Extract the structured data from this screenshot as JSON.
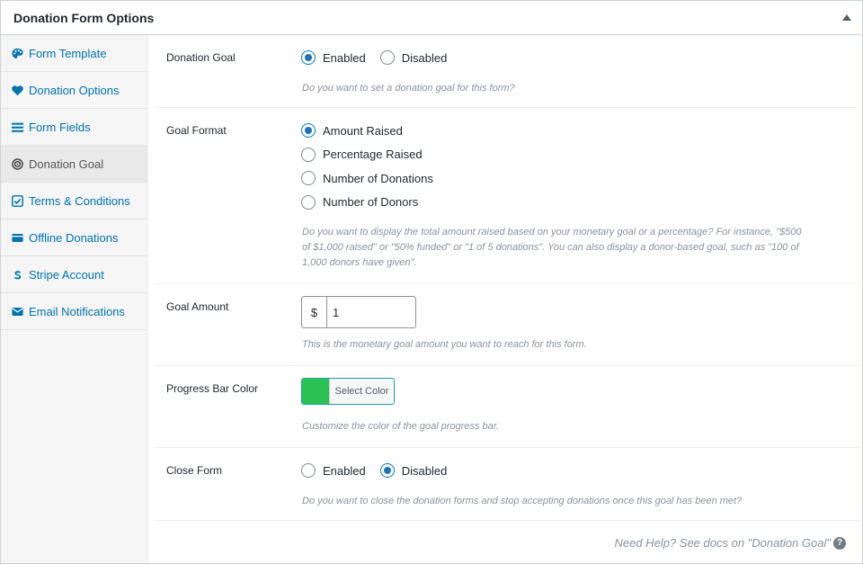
{
  "panel": {
    "title": "Donation Form Options"
  },
  "sidebar": {
    "items": [
      {
        "label": "Form Template",
        "icon": "palette-icon"
      },
      {
        "label": "Donation Options",
        "icon": "heart-icon"
      },
      {
        "label": "Form Fields",
        "icon": "bars-icon"
      },
      {
        "label": "Donation Goal",
        "icon": "target-icon",
        "active": true
      },
      {
        "label": "Terms & Conditions",
        "icon": "checkbox-icon"
      },
      {
        "label": "Offline Donations",
        "icon": "wallet-icon"
      },
      {
        "label": "Stripe Account",
        "icon": "stripe-icon"
      },
      {
        "label": "Email Notifications",
        "icon": "envelope-icon"
      }
    ]
  },
  "fields": {
    "donation_goal": {
      "label": "Donation Goal",
      "options": [
        "Enabled",
        "Disabled"
      ],
      "selected": "Enabled",
      "description": "Do you want to set a donation goal for this form?"
    },
    "goal_format": {
      "label": "Goal Format",
      "options": [
        "Amount Raised",
        "Percentage Raised",
        "Number of Donations",
        "Number of Donors"
      ],
      "selected": "Amount Raised",
      "description_lines": [
        "Do you want to display the total amount raised based on your monetary goal or a percentage? For instance, \"$500",
        "of $1,000 raised\" or \"50% funded\" or \"1 of 5 donations\". You can also display a donor-based goal, such as \"100 of",
        "1,000 donors have given\"."
      ]
    },
    "goal_amount": {
      "label": "Goal Amount",
      "currency": "$",
      "value": "1",
      "description": "This is the monetary goal amount you want to reach for this form."
    },
    "progress_bar_color": {
      "label": "Progress Bar Color",
      "color": "#2bc253",
      "button_label": "Select Color",
      "description": "Customize the color of the goal progress bar."
    },
    "close_form": {
      "label": "Close Form",
      "options": [
        "Enabled",
        "Disabled"
      ],
      "selected": "Disabled",
      "description": "Do you want to close the donation forms and stop accepting donations once this goal has been met?"
    }
  },
  "help": {
    "text": "Need Help? See docs on \"Donation Goal\"",
    "icon": "question-icon",
    "glyph": "?"
  },
  "colors": {
    "link": "#0073aa",
    "accent": "#2271b1"
  }
}
